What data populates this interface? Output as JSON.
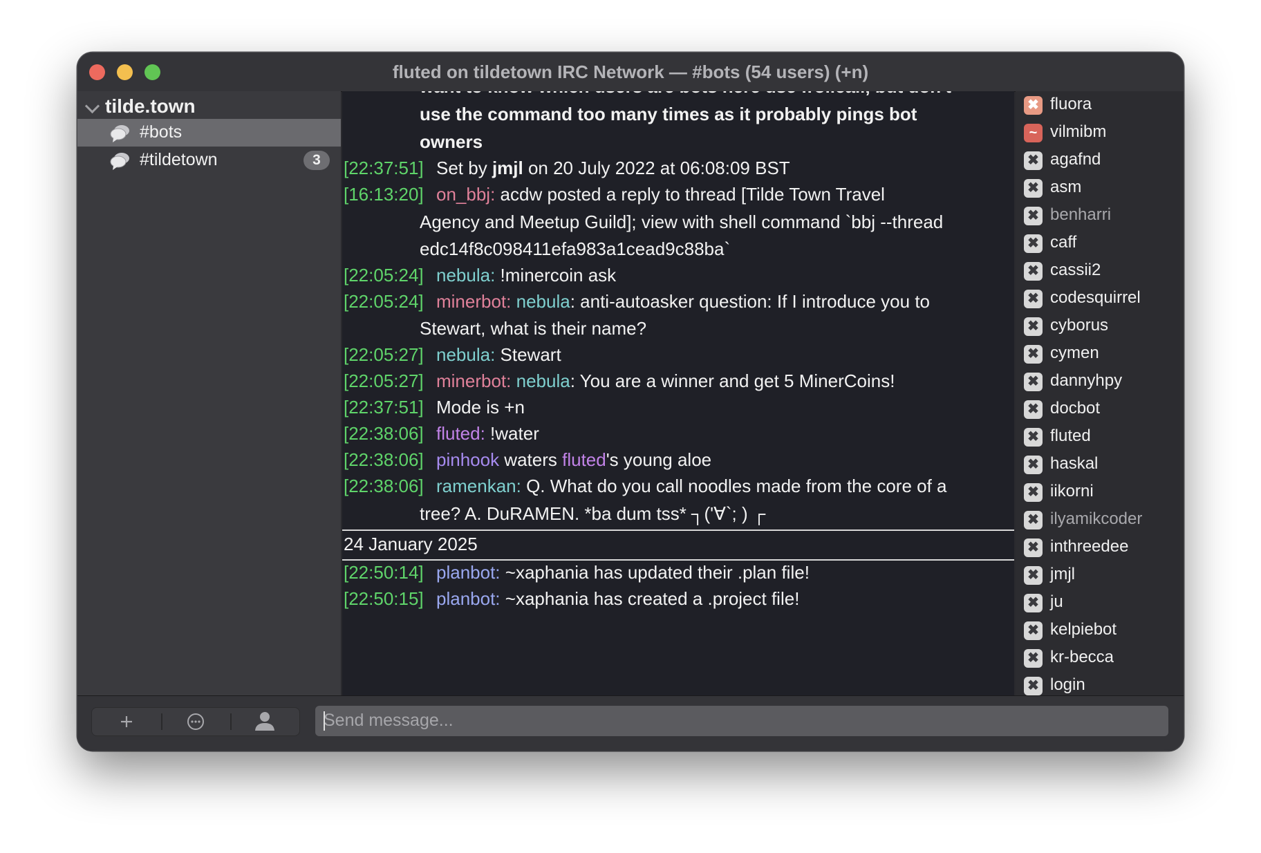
{
  "window": {
    "title": "fluted on tildetown IRC Network — #bots (54 users) (+n)"
  },
  "sidebar": {
    "server": "tilde.town",
    "channels": [
      {
        "name": "#bots",
        "badge": ""
      },
      {
        "name": "#tildetown",
        "badge": "3"
      }
    ]
  },
  "chat": {
    "topic_partial": "want to know which users are bots here use !rollcall, but don't",
    "topic_line2": "use the command too many times as it probably pings bot",
    "topic_line3": "owners",
    "lines": [
      {
        "ts": "[22:37:51]",
        "pre": "Set by ",
        "who": "jmjl",
        "post": " on 20 July 2022 at 06:08:09 BST"
      },
      {
        "ts": "[16:13:20]",
        "nick": "on_bbj:",
        "text": " acdw posted a reply to thread [Tilde Town Travel",
        "cont1": "Agency and Meetup Guild]; view with shell command `bbj --thread",
        "cont2": "edc14f8c098411efa983a1cead9c88ba`"
      },
      {
        "ts": "[22:05:24]",
        "nick": "nebula:",
        "text": " !minercoin ask"
      },
      {
        "ts": "[22:05:24]",
        "nick": "minerbot:",
        "mention": "nebula",
        "text": ": anti-autoasker question: If I introduce you to",
        "cont1": "Stewart, what is their name?"
      },
      {
        "ts": "[22:05:27]",
        "nick": "nebula:",
        "text": " Stewart"
      },
      {
        "ts": "[22:05:27]",
        "nick": "minerbot:",
        "mention": "nebula",
        "text": ": You are a winner and get 5 MinerCoins!"
      },
      {
        "ts": "[22:37:51]",
        "text": "Mode is +n"
      },
      {
        "ts": "[22:38:06]",
        "nick": "fluted:",
        "text": " !water"
      },
      {
        "ts": "[22:38:06]",
        "nick": "pinhook",
        "text": " waters ",
        "mention": "fluted",
        "post": "'s young aloe"
      },
      {
        "ts": "[22:38:06]",
        "nick": "ramenkan:",
        "text": " Q. What do you call noodles made from the core of a",
        "cont1": "tree? A. DuRAMEN. *ba dum tss* ┐('∀`; ) ┌"
      },
      {
        "ts": "[22:50:14]",
        "nick": "planbot:",
        "text": " ~xaphania has updated their .plan file!"
      },
      {
        "ts": "[22:50:15]",
        "nick": "planbot:",
        "text": " ~xaphania has created a .project file!"
      }
    ],
    "date_separator": "24 January 2025"
  },
  "users": [
    {
      "name": "fluora",
      "badge": "✖",
      "mode": "op",
      "away": false
    },
    {
      "name": "vilmibm",
      "badge": "~",
      "mode": "half",
      "away": false
    },
    {
      "name": "agafnd",
      "badge": "✖",
      "mode": "",
      "away": false
    },
    {
      "name": "asm",
      "badge": "✖",
      "mode": "",
      "away": false
    },
    {
      "name": "benharri",
      "badge": "✖",
      "mode": "",
      "away": true
    },
    {
      "name": "caff",
      "badge": "✖",
      "mode": "",
      "away": false
    },
    {
      "name": "cassii2",
      "badge": "✖",
      "mode": "",
      "away": false
    },
    {
      "name": "codesquirrel",
      "badge": "✖",
      "mode": "",
      "away": false
    },
    {
      "name": "cyborus",
      "badge": "✖",
      "mode": "",
      "away": false
    },
    {
      "name": "cymen",
      "badge": "✖",
      "mode": "",
      "away": false
    },
    {
      "name": "dannyhpy",
      "badge": "✖",
      "mode": "",
      "away": false
    },
    {
      "name": "docbot",
      "badge": "✖",
      "mode": "",
      "away": false
    },
    {
      "name": "fluted",
      "badge": "✖",
      "mode": "",
      "away": false
    },
    {
      "name": "haskal",
      "badge": "✖",
      "mode": "",
      "away": false
    },
    {
      "name": "iikorni",
      "badge": "✖",
      "mode": "",
      "away": false
    },
    {
      "name": "ilyamikcoder",
      "badge": "✖",
      "mode": "",
      "away": true
    },
    {
      "name": "inthreedee",
      "badge": "✖",
      "mode": "",
      "away": false
    },
    {
      "name": "jmjl",
      "badge": "✖",
      "mode": "",
      "away": false
    },
    {
      "name": "ju",
      "badge": "✖",
      "mode": "",
      "away": false
    },
    {
      "name": "kelpiebot",
      "badge": "✖",
      "mode": "",
      "away": false
    },
    {
      "name": "kr-becca",
      "badge": "✖",
      "mode": "",
      "away": false
    },
    {
      "name": "login",
      "badge": "✖",
      "mode": "",
      "away": false
    }
  ],
  "bottombar": {
    "add_icon": "plus-icon",
    "more_icon": "ellipsis-circle-icon",
    "user_icon": "person-icon",
    "input_placeholder": "Send message..."
  }
}
